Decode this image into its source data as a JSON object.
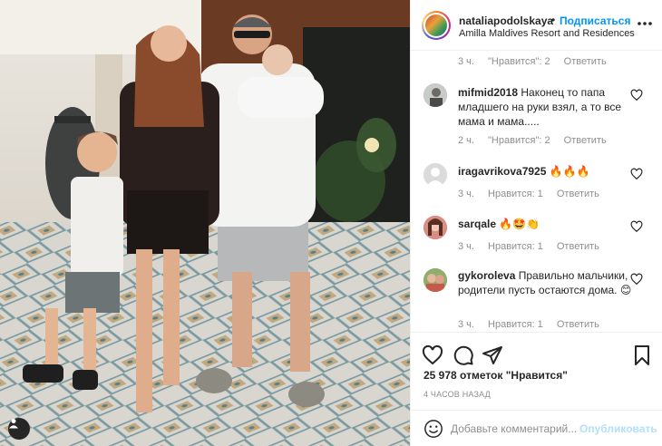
{
  "post": {
    "username": "nataliapodolskaya",
    "follow_label": "Подписаться",
    "location": "Amilla Maldives Resort and Residences",
    "likes_text": "25 978 отметок \"Нравится\"",
    "time_ago": "4 ЧАСОВ НАЗАД",
    "comment_placeholder": "Добавьте комментарий...",
    "publish_label": "Опубликовать",
    "header_dot": "•"
  },
  "top_meta": {
    "time": "3 ч.",
    "likes": "\"Нравится\": 2",
    "reply": "Ответить"
  },
  "comments": [
    {
      "user": "mifmid2018",
      "text": "Наконец то папа младшего на руки взял, а то все мама и мама.....",
      "time": "2 ч.",
      "likes": "\"Нравится\": 2",
      "reply": "Ответить"
    },
    {
      "user": "iragavrikova7925",
      "text": "🔥🔥🔥",
      "time": "3 ч.",
      "likes": "Нравится: 1",
      "reply": "Ответить"
    },
    {
      "user": "sarqale",
      "text": "🔥🤩👏",
      "time": "3 ч.",
      "likes": "Нравится: 1",
      "reply": "Ответить"
    },
    {
      "user": "gykoroleva",
      "text": "Правильно мальчики, родители пусть остаются дома. 😊",
      "time": "3 ч.",
      "likes": "Нравится: 1",
      "reply": "Ответить"
    }
  ],
  "icons": {
    "like": "heart-icon",
    "comment": "comment-icon",
    "share": "paper-plane-icon",
    "save": "bookmark-icon",
    "more": "more-icon",
    "emoji": "smiley-icon",
    "tag": "person-tag-icon"
  },
  "colors": {
    "link": "#0095f6",
    "muted": "#8e8e8e",
    "text": "#262626",
    "publish_disabled": "#b2dffc"
  }
}
